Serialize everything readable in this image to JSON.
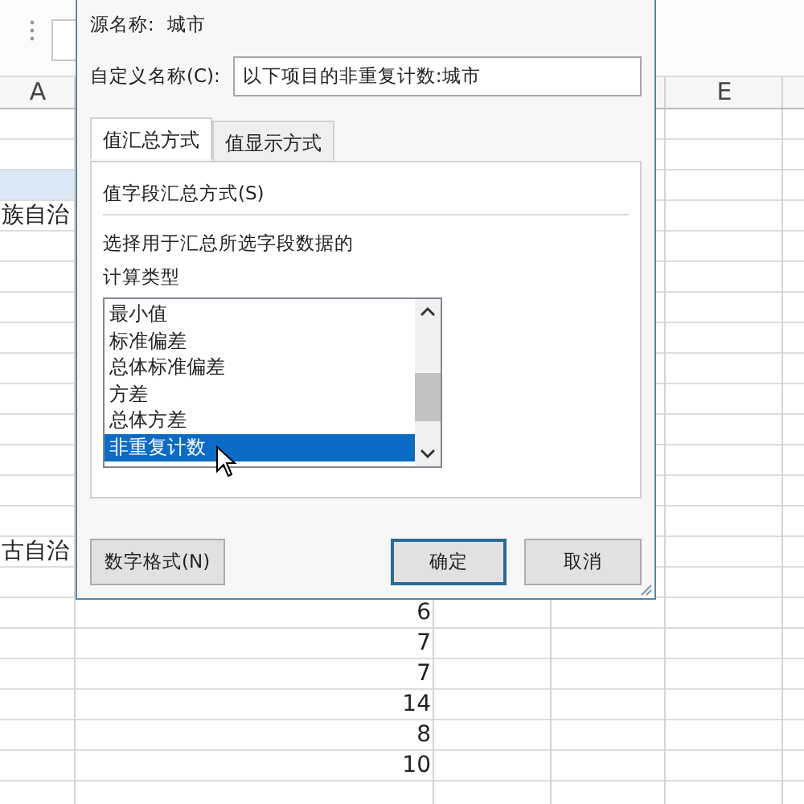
{
  "sheet": {
    "column_headers": [
      {
        "label": "A"
      },
      {
        "label": "E"
      }
    ],
    "rows": [
      {
        "selected": false
      },
      {
        "selected": false
      },
      {
        "selected": true
      },
      {
        "selected": false,
        "column_1": "族自治"
      },
      {
        "selected": false
      },
      {
        "selected": false
      },
      {
        "selected": false
      },
      {
        "selected": false
      },
      {
        "selected": false
      },
      {
        "selected": false
      },
      {
        "selected": false
      },
      {
        "selected": false
      },
      {
        "selected": false
      },
      {
        "selected": false
      },
      {
        "selected": false,
        "column_1": "古自治"
      },
      {
        "selected": false
      },
      {
        "selected": false,
        "column_2": "6"
      },
      {
        "selected": false,
        "column_2": "7"
      },
      {
        "selected": false,
        "column_2": "7"
      },
      {
        "selected": false,
        "column_2": "14"
      },
      {
        "selected": false,
        "column_2": "8"
      },
      {
        "selected": false,
        "column_2": "10"
      }
    ]
  },
  "dialog": {
    "source_label": "源名称:",
    "source_value": "城市",
    "custom_name_label": "自定义名称(C):",
    "custom_name_value": "以下项目的非重复计数:城市",
    "tabs": [
      {
        "label": "值汇总方式",
        "selected": true
      },
      {
        "label": "值显示方式",
        "selected": false
      }
    ],
    "section_title": "值字段汇总方式(S)",
    "description": "选择用于汇总所选字段数据的",
    "list_label": "计算类型",
    "calculation_types": [
      {
        "label": "最小值",
        "selected": false
      },
      {
        "label": "标准偏差",
        "selected": false
      },
      {
        "label": "总体标准偏差",
        "selected": false
      },
      {
        "label": "方差",
        "selected": false
      },
      {
        "label": "总体方差",
        "selected": false
      },
      {
        "label": "非重复计数",
        "selected": true
      }
    ],
    "buttons": [
      {
        "label": "数字格式(N)",
        "kind": "normal"
      },
      {
        "label": "确定",
        "kind": "default"
      },
      {
        "label": "取消",
        "kind": "normal"
      }
    ]
  }
}
